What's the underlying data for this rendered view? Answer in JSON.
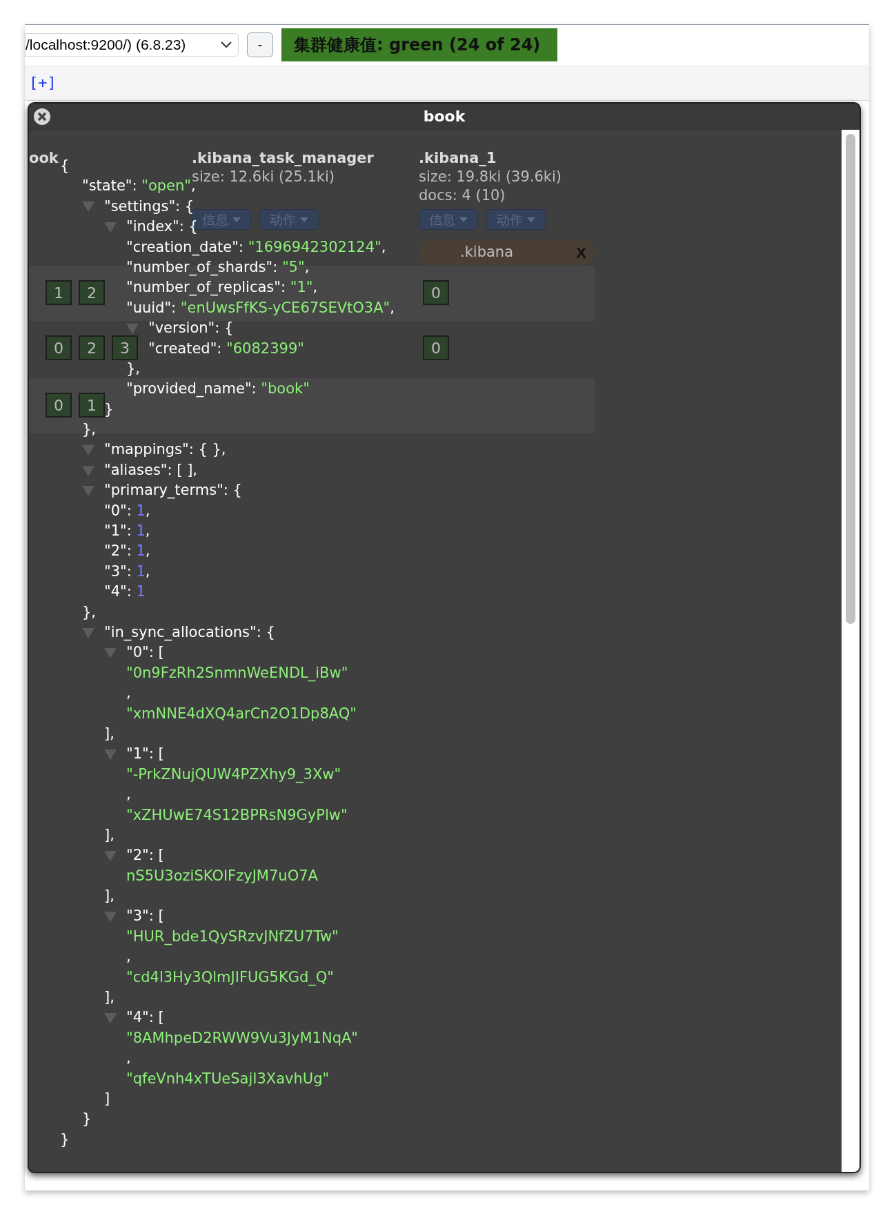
{
  "toolbar": {
    "cluster_select": "/localhost:9200/) (6.8.23)",
    "disconnect_button": "-",
    "health": "集群健康值: green (24 of 24)",
    "add_tab_link": "[+]"
  },
  "overview": {
    "indices": [
      {
        "name": "ook"
      },
      {
        "name": ".kibana_task_manager",
        "size": "size: 12.6ki (25.1ki)",
        "buttons": [
          "信息",
          "动作"
        ]
      },
      {
        "name": ".kibana_1",
        "size": "size: 19.8ki (39.6ki)",
        "docs": "docs: 4 (10)",
        "buttons": [
          "信息",
          "动作"
        ]
      }
    ],
    "alias": {
      "label": ".kibana",
      "remove": "X"
    },
    "shard_rows": [
      [
        [
          "1",
          "2"
        ],
        [],
        [
          "0"
        ]
      ],
      [
        [
          "0",
          "2",
          "3"
        ],
        [],
        [
          "0"
        ]
      ],
      [
        [
          "0",
          "1"
        ],
        [],
        []
      ]
    ]
  },
  "dialog": {
    "title": "book",
    "tree": {
      "segments": [
        {
          "kind": "plain",
          "text": "{"
        }
      ],
      "children": [
        {
          "segments": [
            {
              "kind": "plain",
              "text": "\"state\": "
            },
            {
              "kind": "string",
              "text": "\"open\""
            },
            {
              "kind": "plain",
              "text": ","
            }
          ]
        },
        {
          "segments": [
            {
              "kind": "plain",
              "text": "\"settings\": {"
            }
          ],
          "expanded": true,
          "children": [
            {
              "segments": [
                {
                  "kind": "plain",
                  "text": "\"index\": {"
                }
              ],
              "expanded": true,
              "children": [
                {
                  "segments": [
                    {
                      "kind": "plain",
                      "text": "\"creation_date\": "
                    },
                    {
                      "kind": "string",
                      "text": "\"1696942302124\""
                    },
                    {
                      "kind": "plain",
                      "text": ","
                    }
                  ]
                },
                {
                  "segments": [
                    {
                      "kind": "plain",
                      "text": "\"number_of_shards\": "
                    },
                    {
                      "kind": "string",
                      "text": "\"5\""
                    },
                    {
                      "kind": "plain",
                      "text": ","
                    }
                  ]
                },
                {
                  "segments": [
                    {
                      "kind": "plain",
                      "text": "\"number_of_replicas\": "
                    },
                    {
                      "kind": "string",
                      "text": "\"1\""
                    },
                    {
                      "kind": "plain",
                      "text": ","
                    }
                  ]
                },
                {
                  "segments": [
                    {
                      "kind": "plain",
                      "text": "\"uuid\": "
                    },
                    {
                      "kind": "string",
                      "text": "\"enUwsFfKS-yCE67SEVtO3A\""
                    },
                    {
                      "kind": "plain",
                      "text": ","
                    }
                  ]
                },
                {
                  "segments": [
                    {
                      "kind": "plain",
                      "text": "\"version\": {"
                    }
                  ],
                  "expanded": true,
                  "children": [
                    {
                      "segments": [
                        {
                          "kind": "plain",
                          "text": "\"created\": "
                        },
                        {
                          "kind": "string",
                          "text": "\"6082399\""
                        }
                      ]
                    }
                  ],
                  "closing": [
                    {
                      "kind": "plain",
                      "text": "},"
                    }
                  ]
                },
                {
                  "segments": [
                    {
                      "kind": "plain",
                      "text": "\"provided_name\": "
                    },
                    {
                      "kind": "string",
                      "text": "\"book\""
                    }
                  ]
                }
              ],
              "closing": [
                {
                  "kind": "plain",
                  "text": "}"
                }
              ]
            }
          ],
          "closing": [
            {
              "kind": "plain",
              "text": "},"
            }
          ]
        },
        {
          "segments": [
            {
              "kind": "plain",
              "text": "\"mappings\": { },"
            }
          ],
          "expanded": true
        },
        {
          "segments": [
            {
              "kind": "plain",
              "text": "\"aliases\": [ ],"
            }
          ],
          "expanded": true
        },
        {
          "segments": [
            {
              "kind": "plain",
              "text": "\"primary_terms\": {"
            }
          ],
          "expanded": true,
          "children": [
            {
              "segments": [
                {
                  "kind": "plain",
                  "text": "\"0\": "
                },
                {
                  "kind": "number",
                  "text": "1"
                },
                {
                  "kind": "plain",
                  "text": ","
                }
              ]
            },
            {
              "segments": [
                {
                  "kind": "plain",
                  "text": "\"1\": "
                },
                {
                  "kind": "number",
                  "text": "1"
                },
                {
                  "kind": "plain",
                  "text": ","
                }
              ]
            },
            {
              "segments": [
                {
                  "kind": "plain",
                  "text": "\"2\": "
                },
                {
                  "kind": "number",
                  "text": "1"
                },
                {
                  "kind": "plain",
                  "text": ","
                }
              ]
            },
            {
              "segments": [
                {
                  "kind": "plain",
                  "text": "\"3\": "
                },
                {
                  "kind": "number",
                  "text": "1"
                },
                {
                  "kind": "plain",
                  "text": ","
                }
              ]
            },
            {
              "segments": [
                {
                  "kind": "plain",
                  "text": "\"4\": "
                },
                {
                  "kind": "number",
                  "text": "1"
                }
              ]
            }
          ],
          "closing": [
            {
              "kind": "plain",
              "text": "},"
            }
          ]
        },
        {
          "segments": [
            {
              "kind": "plain",
              "text": "\"in_sync_allocations\": {"
            }
          ],
          "expanded": true,
          "children": [
            {
              "segments": [
                {
                  "kind": "plain",
                  "text": "\"0\": ["
                }
              ],
              "expanded": true,
              "children": [
                {
                  "segments": [
                    {
                      "kind": "string",
                      "text": "\"0n9FzRh2SnmnWeENDL_iBw\""
                    }
                  ]
                },
                {
                  "segments": [
                    {
                      "kind": "plain",
                      "text": ","
                    }
                  ]
                },
                {
                  "segments": [
                    {
                      "kind": "string",
                      "text": "\"xmNNE4dXQ4arCn2O1Dp8AQ\""
                    }
                  ]
                }
              ],
              "closing": [
                {
                  "kind": "plain",
                  "text": "],"
                }
              ]
            },
            {
              "segments": [
                {
                  "kind": "plain",
                  "text": "\"1\": ["
                }
              ],
              "expanded": true,
              "children": [
                {
                  "segments": [
                    {
                      "kind": "string",
                      "text": "\"-PrkZNujQUW4PZXhy9_3Xw\""
                    }
                  ]
                },
                {
                  "segments": [
                    {
                      "kind": "plain",
                      "text": ","
                    }
                  ]
                },
                {
                  "segments": [
                    {
                      "kind": "string",
                      "text": "\"xZHUwE74S12BPRsN9GyPlw\""
                    }
                  ]
                }
              ],
              "closing": [
                {
                  "kind": "plain",
                  "text": "],"
                }
              ]
            },
            {
              "segments": [
                {
                  "kind": "plain",
                  "text": "\"2\": ["
                }
              ],
              "expanded": true,
              "children": [
                {
                  "segments": [
                    {
                      "kind": "string",
                      "text": "nS5U3oziSKOIFzyJM7uO7A"
                    }
                  ]
                }
              ],
              "closing": [
                {
                  "kind": "plain",
                  "text": "],"
                }
              ]
            },
            {
              "segments": [
                {
                  "kind": "plain",
                  "text": "\"3\": ["
                }
              ],
              "expanded": true,
              "children": [
                {
                  "segments": [
                    {
                      "kind": "string",
                      "text": "\"HUR_bde1QySRzvJNfZU7Tw\""
                    }
                  ]
                },
                {
                  "segments": [
                    {
                      "kind": "plain",
                      "text": ","
                    }
                  ]
                },
                {
                  "segments": [
                    {
                      "kind": "string",
                      "text": "\"cd4l3Hy3QlmJIFUG5KGd_Q\""
                    }
                  ]
                }
              ],
              "closing": [
                {
                  "kind": "plain",
                  "text": "],"
                }
              ]
            },
            {
              "segments": [
                {
                  "kind": "plain",
                  "text": "\"4\": ["
                }
              ],
              "expanded": true,
              "children": [
                {
                  "segments": [
                    {
                      "kind": "string",
                      "text": "\"8AMhpeD2RWW9Vu3JyM1NqA\""
                    }
                  ]
                },
                {
                  "segments": [
                    {
                      "kind": "plain",
                      "text": ","
                    }
                  ]
                },
                {
                  "segments": [
                    {
                      "kind": "string",
                      "text": "\"qfeVnh4xTUeSajI3XavhUg\""
                    }
                  ]
                }
              ],
              "closing": [
                {
                  "kind": "plain",
                  "text": "]"
                }
              ]
            }
          ],
          "closing": [
            {
              "kind": "plain",
              "text": "}"
            }
          ]
        }
      ],
      "closing": [
        {
          "kind": "plain",
          "text": "}"
        }
      ]
    }
  }
}
